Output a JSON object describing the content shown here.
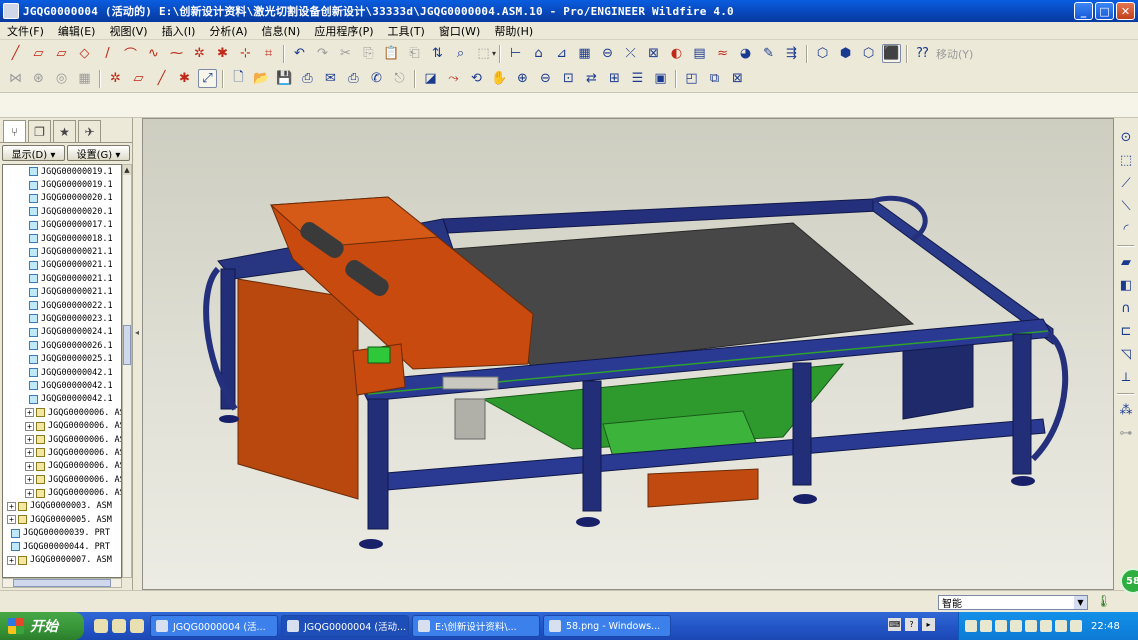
{
  "window": {
    "title": "JGQG0000004 (活动的) E:\\创新设计资料\\激光切割设备创新设计\\33333d\\JGQG0000004.ASM.10 - Pro/ENGINEER Wildfire 4.0",
    "buttons": {
      "minimize": "_",
      "maximize": "□",
      "close": "✕"
    }
  },
  "menu": {
    "items": [
      "文件(F)",
      "编辑(E)",
      "视图(V)",
      "插入(I)",
      "分析(A)",
      "信息(N)",
      "应用程序(P)",
      "工具(T)",
      "窗口(W)",
      "帮助(H)"
    ]
  },
  "toolbar": {
    "move_label": "移动(Y)"
  },
  "left_panel": {
    "tabs": [
      "model-tree",
      "folder-browser",
      "favorites",
      "connections"
    ],
    "show_button": "显示(D) ▾",
    "settings_button": "设置(G) ▾",
    "tree_items": [
      {
        "label": "JGQG00000019.1",
        "type": "prt",
        "expandable": false,
        "indent": 1
      },
      {
        "label": "JGQG00000019.1",
        "type": "prt",
        "expandable": false,
        "indent": 1
      },
      {
        "label": "JGQG00000020.1",
        "type": "prt",
        "expandable": false,
        "indent": 1
      },
      {
        "label": "JGQG00000020.1",
        "type": "prt",
        "expandable": false,
        "indent": 1
      },
      {
        "label": "JGQG00000017.1",
        "type": "prt",
        "expandable": false,
        "indent": 1
      },
      {
        "label": "JGQG00000018.1",
        "type": "prt",
        "expandable": false,
        "indent": 1
      },
      {
        "label": "JGQG00000021.1",
        "type": "prt",
        "expandable": false,
        "indent": 1
      },
      {
        "label": "JGQG00000021.1",
        "type": "prt",
        "expandable": false,
        "indent": 1
      },
      {
        "label": "JGQG00000021.1",
        "type": "prt",
        "expandable": false,
        "indent": 1
      },
      {
        "label": "JGQG00000021.1",
        "type": "prt",
        "expandable": false,
        "indent": 1
      },
      {
        "label": "JGQG00000022.1",
        "type": "prt",
        "expandable": false,
        "indent": 1
      },
      {
        "label": "JGQG00000023.1",
        "type": "prt",
        "expandable": false,
        "indent": 1
      },
      {
        "label": "JGQG00000024.1",
        "type": "prt",
        "expandable": false,
        "indent": 1
      },
      {
        "label": "JGQG00000026.1",
        "type": "prt",
        "expandable": false,
        "indent": 1
      },
      {
        "label": "JGQG00000025.1",
        "type": "prt",
        "expandable": false,
        "indent": 1
      },
      {
        "label": "JGQG00000042.1",
        "type": "prt",
        "expandable": false,
        "indent": 1
      },
      {
        "label": "JGQG00000042.1",
        "type": "prt",
        "expandable": false,
        "indent": 1
      },
      {
        "label": "JGQG00000042.1",
        "type": "prt",
        "expandable": false,
        "indent": 1
      },
      {
        "label": "JGQG0000006. AS",
        "type": "asm",
        "expandable": true,
        "indent": 1
      },
      {
        "label": "JGQG0000006. AS",
        "type": "asm",
        "expandable": true,
        "indent": 1
      },
      {
        "label": "JGQG0000006. AS",
        "type": "asm",
        "expandable": true,
        "indent": 1
      },
      {
        "label": "JGQG0000006. AS",
        "type": "asm",
        "expandable": true,
        "indent": 1
      },
      {
        "label": "JGQG0000006. AS",
        "type": "asm",
        "expandable": true,
        "indent": 1
      },
      {
        "label": "JGQG0000006. AS",
        "type": "asm",
        "expandable": true,
        "indent": 1
      },
      {
        "label": "JGQG0000006. AS",
        "type": "asm",
        "expandable": true,
        "indent": 1
      },
      {
        "label": "JGQG0000003. ASM",
        "type": "asm",
        "expandable": true,
        "indent": 0
      },
      {
        "label": "JGQG0000005. ASM",
        "type": "asm",
        "expandable": true,
        "indent": 0
      },
      {
        "label": "JGQG00000039. PRT",
        "type": "prt",
        "expandable": false,
        "indent": 0
      },
      {
        "label": "JGQG00000044. PRT",
        "type": "prt",
        "expandable": false,
        "indent": 0
      },
      {
        "label": "JGQG0000007. ASM",
        "type": "asm",
        "expandable": true,
        "indent": 0
      }
    ]
  },
  "status": {
    "filter_value": "智能"
  },
  "badge": "58",
  "taskbar": {
    "start_label": "开始",
    "tasks": [
      {
        "label": "JGQG0000004 (活...",
        "active": false
      },
      {
        "label": "JGQG0000004 (活动...",
        "active": true
      },
      {
        "label": "E:\\创新设计资料\\...",
        "active": false
      },
      {
        "label": "58.png - Windows...",
        "active": false
      }
    ],
    "clock": "22:48"
  },
  "colors": {
    "frame": "#1c2a78",
    "laser_head": "#c84a0e",
    "hopper": "#2e9a2e",
    "table_surface": "#474747",
    "panel_orange": "#c04a10"
  }
}
